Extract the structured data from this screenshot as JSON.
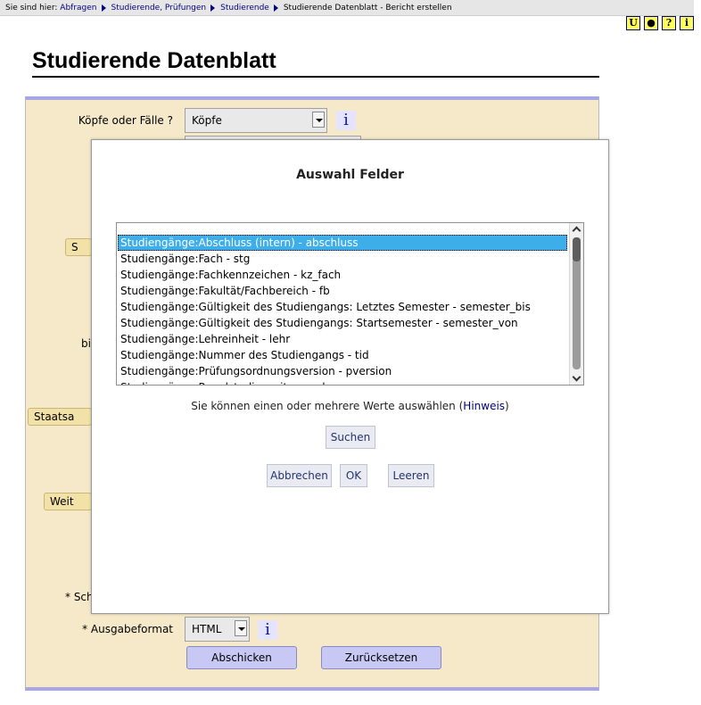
{
  "breadcrumb": {
    "prefix": "Sie sind hier:",
    "items": [
      "Abfragen",
      "Studierende, Prüfungen",
      "Studierende"
    ],
    "current": "Studierende Datenblatt - Bericht erstellen"
  },
  "top_icons": [
    {
      "name": "logo-icon",
      "glyph": "U"
    },
    {
      "name": "dot-icon",
      "glyph": "●"
    },
    {
      "name": "help-icon",
      "glyph": "?"
    },
    {
      "name": "info-icon",
      "glyph": "i"
    }
  ],
  "page": {
    "title": "Studierende Datenblatt"
  },
  "form": {
    "koepfe_label": "Köpfe oder Fälle ?",
    "koepfe_value": "Köpfe",
    "info_glyph": "i",
    "partial_label_bi": "bi",
    "side_button_s": "S",
    "side_button_staatsa": "Staatsa",
    "side_button_weit": "Weit",
    "partial_label_sch": "* Sch",
    "ausgabe_label": "* Ausgabeformat",
    "ausgabe_value": "HTML",
    "submit_label": "Abschicken",
    "reset_label": "Zurücksetzen"
  },
  "modal": {
    "title": "Auswahl Felder",
    "items": [
      "Studiengänge:Abschluss (intern) - abschluss",
      "Studiengänge:Fach - stg",
      "Studiengänge:Fachkennzeichen - kz_fach",
      "Studiengänge:Fakultät/Fachbereich - fb",
      "Studiengänge:Gültigkeit des Studiengangs: Letztes Semester - semester_bis",
      "Studiengänge:Gültigkeit des Studiengangs: Startsemester - semester_von",
      "Studiengänge:Lehreinheit - lehr",
      "Studiengänge:Nummer des Studiengangs - tid",
      "Studiengänge:Prüfungsordnungsversion - pversion",
      "Studiengänge:Regelstudienzeit - regel"
    ],
    "selected_index": 0,
    "hint_text": "Sie können einen oder mehrere Werte auswählen (",
    "hint_link": "Hinweis",
    "hint_close": ")",
    "search_label": "Suchen",
    "cancel_label": "Abbrechen",
    "ok_label": "OK",
    "clear_label": "Leeren"
  }
}
